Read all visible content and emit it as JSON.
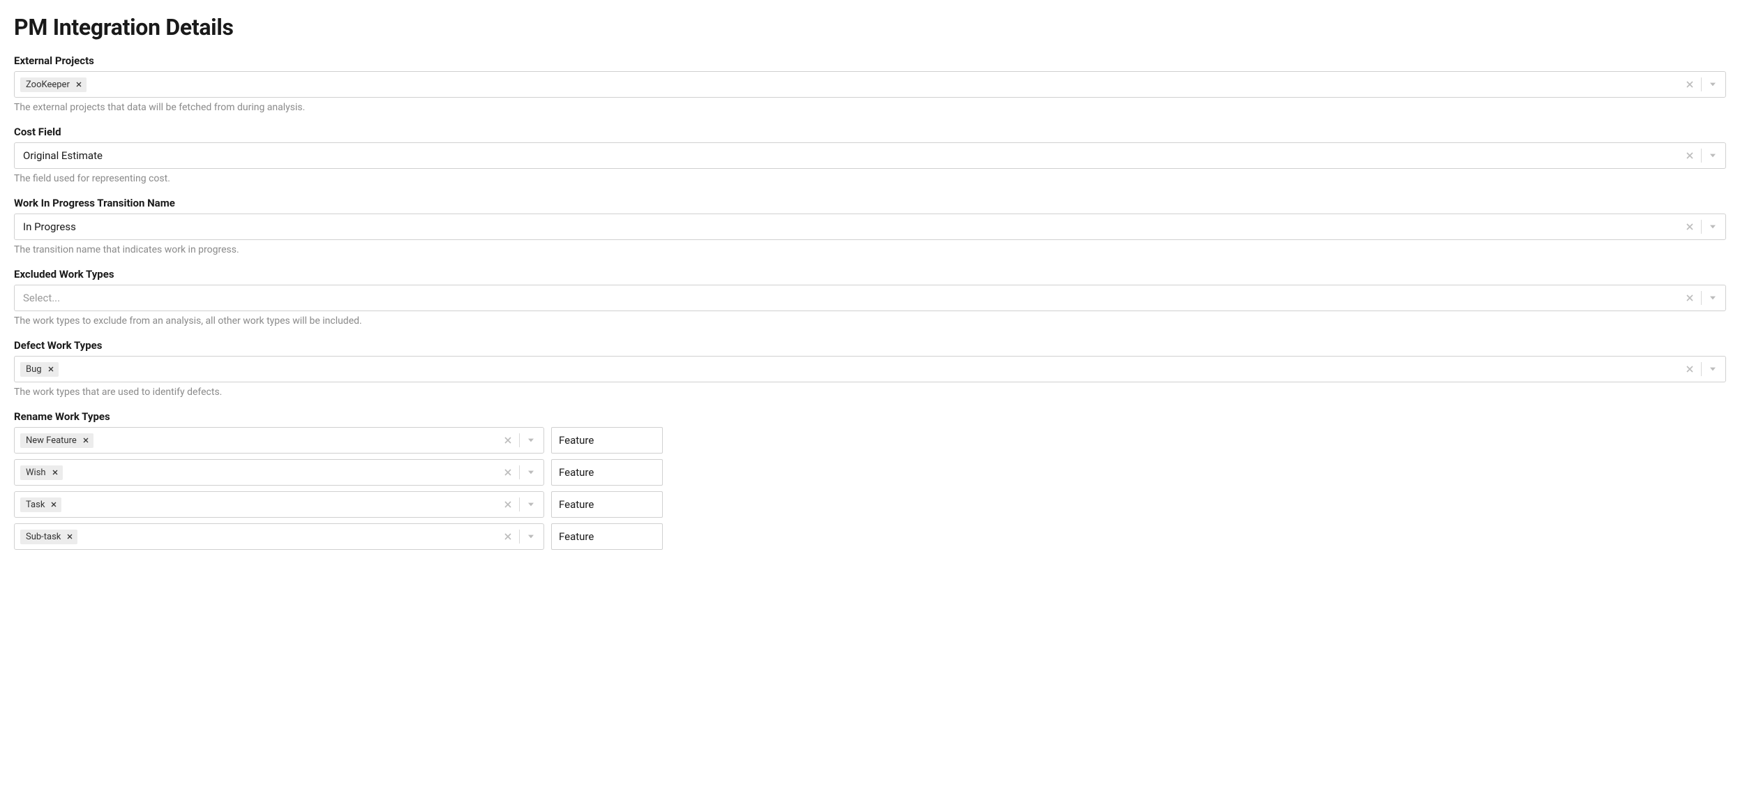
{
  "page": {
    "title": "PM Integration Details"
  },
  "fields": {
    "external_projects": {
      "label": "External Projects",
      "chips": [
        "ZooKeeper"
      ],
      "help": "The external projects that data will be fetched from during analysis."
    },
    "cost_field": {
      "label": "Cost Field",
      "value": "Original Estimate",
      "help": "The field used for representing cost."
    },
    "wip_transition": {
      "label": "Work In Progress Transition Name",
      "value": "In Progress",
      "help": "The transition name that indicates work in progress."
    },
    "excluded_work_types": {
      "label": "Excluded Work Types",
      "placeholder": "Select...",
      "help": "The work types to exclude from an analysis, all other work types will be included."
    },
    "defect_work_types": {
      "label": "Defect Work Types",
      "chips": [
        "Bug"
      ],
      "help": "The work types that are used to identify defects."
    },
    "rename_work_types": {
      "label": "Rename Work Types",
      "rows": [
        {
          "chip": "New Feature",
          "target": "Feature"
        },
        {
          "chip": "Wish",
          "target": "Feature"
        },
        {
          "chip": "Task",
          "target": "Feature"
        },
        {
          "chip": "Sub-task",
          "target": "Feature"
        }
      ]
    }
  }
}
